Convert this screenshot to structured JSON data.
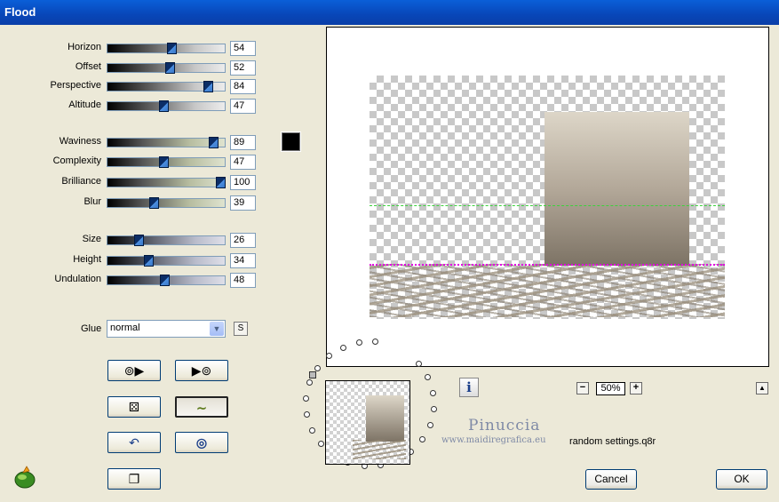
{
  "window": {
    "title": "Flood"
  },
  "sliders": [
    {
      "key": "horizon",
      "label": "Horizon",
      "value": 54,
      "tone": "gray"
    },
    {
      "key": "offset",
      "label": "Offset",
      "value": 52,
      "tone": "gray"
    },
    {
      "key": "perspective",
      "label": "Perspective",
      "value": 84,
      "tone": "gray"
    },
    {
      "key": "altitude",
      "label": "Altitude",
      "value": 47,
      "tone": "gray"
    },
    {
      "key": "waviness",
      "label": "Waviness",
      "value": 89,
      "tone": "green"
    },
    {
      "key": "complexity",
      "label": "Complexity",
      "value": 47,
      "tone": "green"
    },
    {
      "key": "brilliance",
      "label": "Brilliance",
      "value": 100,
      "tone": "green"
    },
    {
      "key": "blur",
      "label": "Blur",
      "value": 39,
      "tone": "green"
    },
    {
      "key": "size",
      "label": "Size",
      "value": 26,
      "tone": "blue"
    },
    {
      "key": "height",
      "label": "Height",
      "value": 34,
      "tone": "blue"
    },
    {
      "key": "undulation",
      "label": "Undulation",
      "value": 48,
      "tone": "blue"
    }
  ],
  "wave_color": "#000000",
  "glue": {
    "label": "Glue",
    "selected": "normal",
    "s_label": "S"
  },
  "preview": {
    "zoom": "50%",
    "object_gradient": [
      "#ddd6c8",
      "#7d7365"
    ]
  },
  "watermark": {
    "name": "Pinuccia",
    "site": "www.maidiregrafica.eu"
  },
  "settings_file": "random settings.q8r",
  "buttons": {
    "cancel": "Cancel",
    "ok": "OK"
  }
}
